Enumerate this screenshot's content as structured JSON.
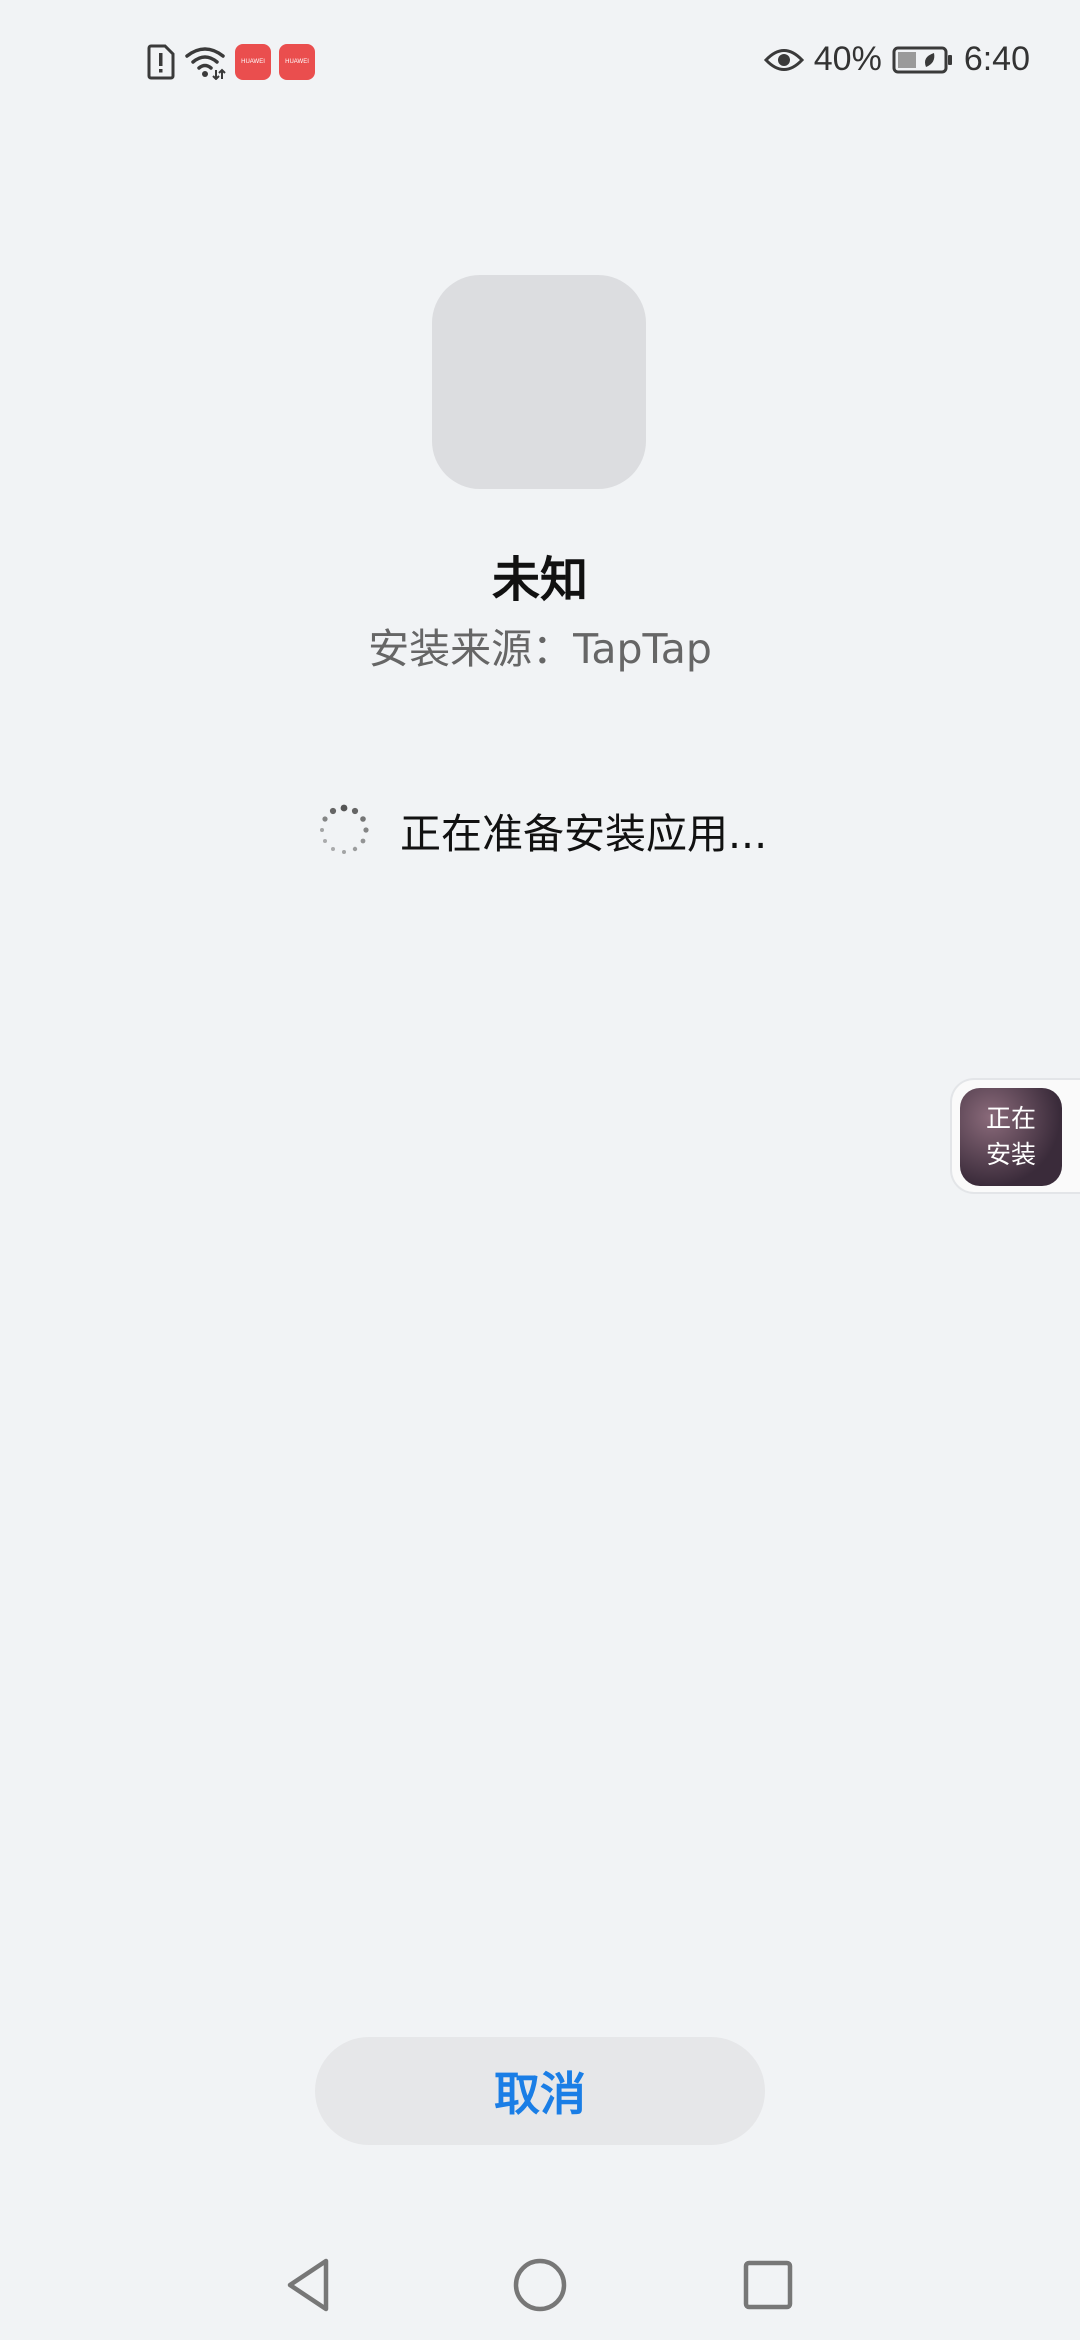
{
  "status_bar": {
    "left_icons": [
      "sim-alert-icon",
      "wifi-icon",
      "huawei-appgallery-icon",
      "huawei-appgallery-icon"
    ],
    "huawei_label": "HUAWEI",
    "battery_percent": "40%",
    "time": "6:40"
  },
  "app": {
    "name": "未知",
    "source": "安装来源：TapTap"
  },
  "progress": {
    "text": "正在准备安装应用..."
  },
  "floating_bubble": {
    "line1": "正在",
    "line2": "安装"
  },
  "actions": {
    "cancel_label": "取消"
  },
  "colors": {
    "background": "#f1f3f5",
    "accent": "#1a7ee6",
    "button_bg": "#e6e7e9",
    "huawei_red": "#ea4e4e"
  },
  "nav_bar": {
    "icons": [
      "back-icon",
      "home-icon",
      "recents-icon"
    ]
  }
}
